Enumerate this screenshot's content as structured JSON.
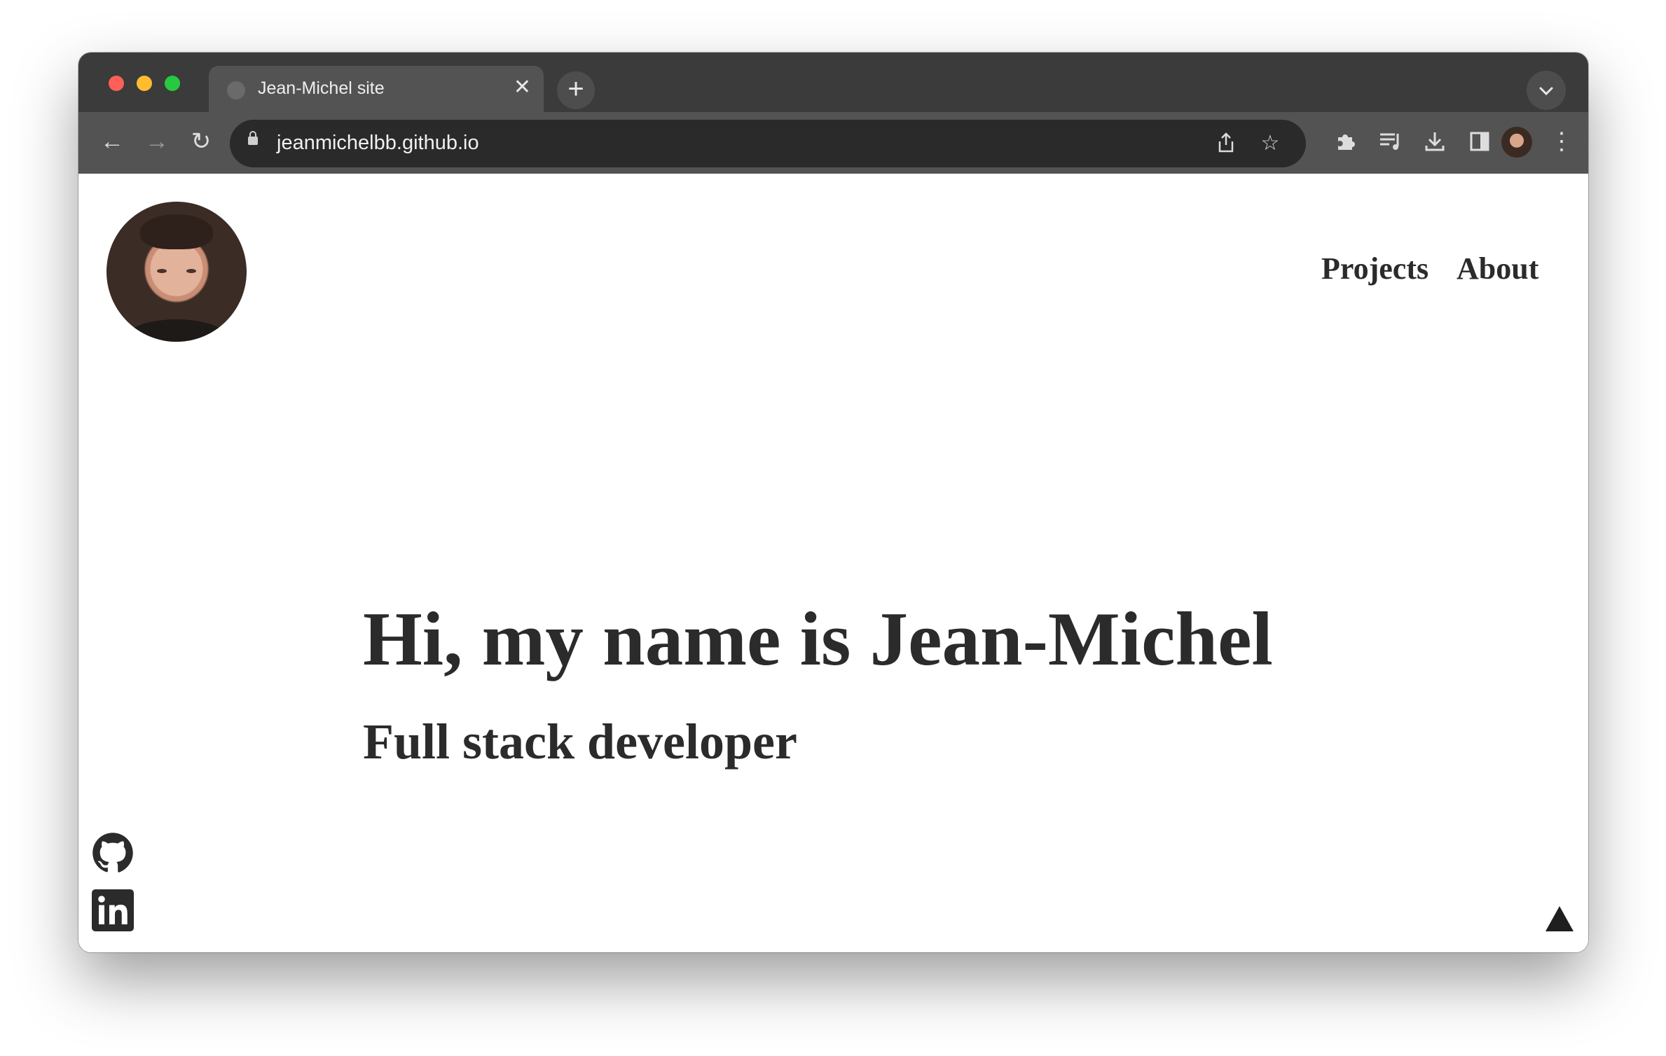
{
  "browser": {
    "tab": {
      "title": "Jean-Michel site",
      "close_label": "✕"
    },
    "new_tab_label": "+",
    "tab_search_label": "⌄",
    "address_bar": {
      "url": "jeanmichelbb.github.io"
    },
    "nav": {
      "back": "←",
      "forward": "→",
      "reload": "↻"
    },
    "omnibox_icons": {
      "share": "⇪",
      "bookmark": "☆"
    },
    "toolbar_icons": {
      "extensions": "puzzle-icon",
      "media": "queue-music-icon",
      "downloads": "download-icon",
      "side_panel": "side-panel-icon",
      "menu": "⋮"
    }
  },
  "site": {
    "nav": [
      {
        "label": "Projects"
      },
      {
        "label": "About"
      }
    ],
    "hero": {
      "title": "Hi, my name is Jean-Michel",
      "subtitle": "Full stack developer"
    },
    "social": [
      "github-icon",
      "linkedin-icon"
    ],
    "colors": {
      "text": "#2b2b2b",
      "background": "#ffffff"
    }
  }
}
